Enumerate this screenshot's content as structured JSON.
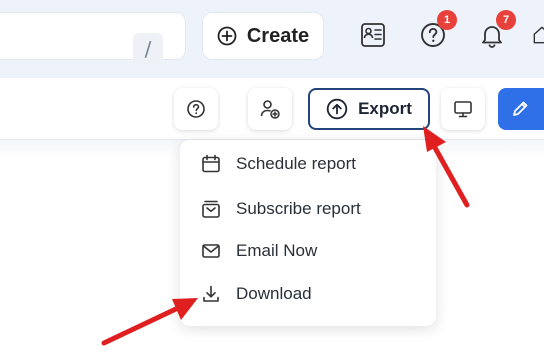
{
  "search": {
    "shortcut": "/"
  },
  "header": {
    "create_label": "Create",
    "help_badge": "1",
    "notifications_badge": "7"
  },
  "toolbar": {
    "export_label": "Export"
  },
  "export_menu": {
    "items": [
      {
        "label": "Schedule report",
        "icon": "calendar-icon"
      },
      {
        "label": "Subscribe report",
        "icon": "subscribe-icon"
      },
      {
        "label": "Email Now",
        "icon": "mail-icon"
      },
      {
        "label": "Download",
        "icon": "download-icon"
      }
    ]
  },
  "colors": {
    "accent_blue": "#2f6fe8",
    "export_border": "#24457c",
    "badge_red": "#e8403a",
    "annotation_red": "#e02020"
  }
}
